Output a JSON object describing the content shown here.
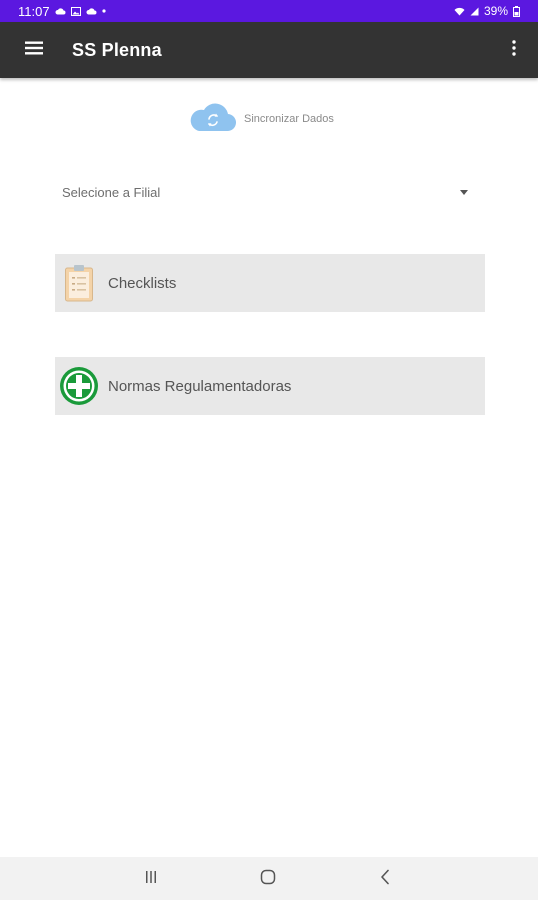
{
  "status_bar": {
    "time": "11:07",
    "battery": "39%",
    "left_icons": [
      "cloud-icon",
      "image-icon",
      "cloud-icon",
      "dot-icon"
    ],
    "right_icons": [
      "wifi-icon",
      "signal-icon",
      "battery-icon"
    ]
  },
  "app_bar": {
    "title": "SS Plenna",
    "menu_icon": "hamburger-menu-icon",
    "overflow_icon": "more-vert-icon"
  },
  "sync": {
    "label": "Sincronizar Dados",
    "icon": "cloud-sync-icon",
    "color": "#8fc3ef"
  },
  "branch_select": {
    "placeholder": "Selecione a Filial"
  },
  "cards": [
    {
      "label": "Checklists",
      "icon": "clipboard-icon"
    },
    {
      "label": "Normas Regulamentadoras",
      "icon": "safety-cross-icon"
    }
  ],
  "colors": {
    "status_bar": "#5b18e0",
    "app_bar": "#333333",
    "card_background": "#e8e8e8",
    "safety_green": "#1a9a3a"
  },
  "nav_bar": {
    "buttons": [
      "recents-icon",
      "home-icon",
      "back-icon"
    ]
  }
}
